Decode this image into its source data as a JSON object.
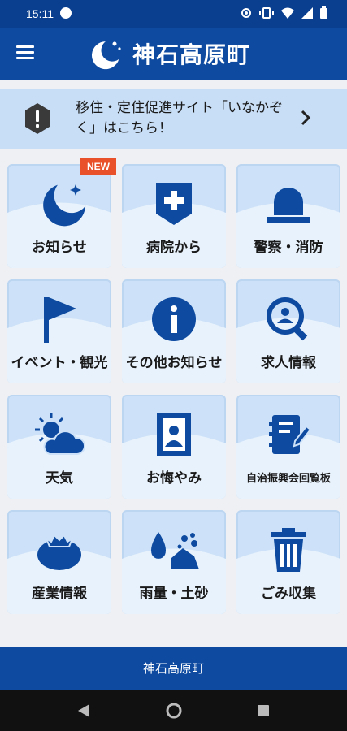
{
  "status_bar": {
    "time": "15:11"
  },
  "app_bar": {
    "title": "神石高原町"
  },
  "banner": {
    "text": "移住・定住促進サイト「いなかぞく」はこちら！"
  },
  "badge": {
    "label": "NEW"
  },
  "tiles": [
    {
      "label": "お知らせ",
      "icon": "moon-star-icon"
    },
    {
      "label": "病院から",
      "icon": "hospital-icon"
    },
    {
      "label": "警察・消防",
      "icon": "siren-icon"
    },
    {
      "label": "イベント・観光",
      "icon": "flag-icon"
    },
    {
      "label": "その他お知らせ",
      "icon": "info-icon"
    },
    {
      "label": "求人情報",
      "icon": "job-search-icon"
    },
    {
      "label": "天気",
      "icon": "weather-icon"
    },
    {
      "label": "お悔やみ",
      "icon": "memorial-icon"
    },
    {
      "label": "自治振興会回覧板",
      "icon": "circular-board-icon"
    },
    {
      "label": "産業情報",
      "icon": "tomato-icon"
    },
    {
      "label": "雨量・土砂",
      "icon": "rain-landslide-icon"
    },
    {
      "label": "ごみ収集",
      "icon": "trash-icon"
    }
  ],
  "footer": {
    "title": "神石高原町"
  },
  "colors": {
    "primary": "#0d4aa0",
    "tile_bg": "#cde2f8",
    "banner_bg": "#c8def6",
    "badge": "#e8512a"
  }
}
